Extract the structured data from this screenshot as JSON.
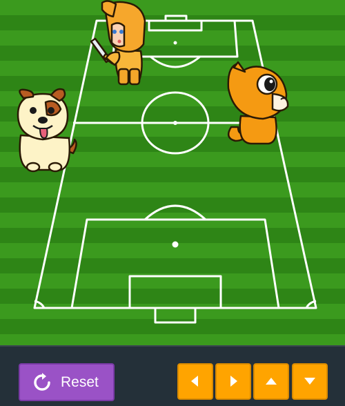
{
  "game": {
    "field_colors": {
      "stripe_light": "#3e9a1f",
      "stripe_dark": "#2f8417",
      "lines": "#ffffff"
    },
    "characters": [
      {
        "name": "knight",
        "icon": "knight-sword-icon"
      },
      {
        "name": "dog",
        "icon": "dog-icon"
      },
      {
        "name": "cat",
        "icon": "cat-icon"
      }
    ]
  },
  "controls": {
    "reset_label": "Reset",
    "reset_color": "#9a52c6",
    "arrow_color": "#ffa400",
    "arrows": [
      "left-arrow-icon",
      "right-arrow-icon",
      "up-arrow-icon",
      "down-arrow-icon"
    ]
  }
}
